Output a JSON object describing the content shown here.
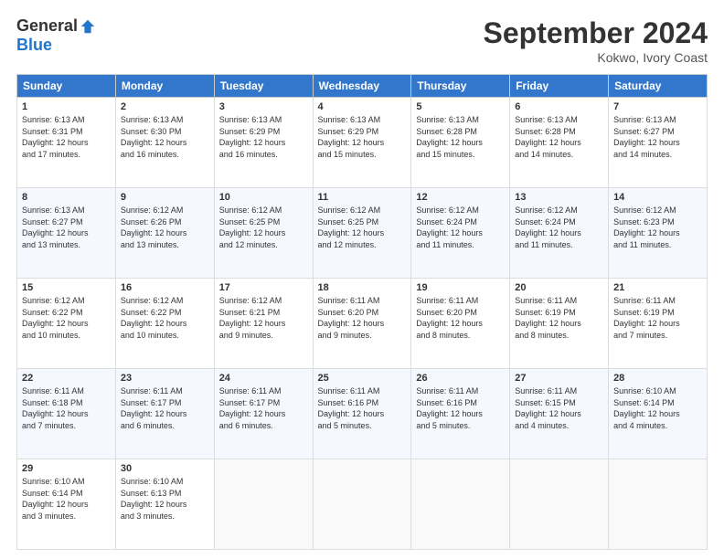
{
  "logo": {
    "general": "General",
    "blue": "Blue"
  },
  "title": "September 2024",
  "location": "Kokwo, Ivory Coast",
  "days_header": [
    "Sunday",
    "Monday",
    "Tuesday",
    "Wednesday",
    "Thursday",
    "Friday",
    "Saturday"
  ],
  "weeks": [
    [
      {
        "day": "1",
        "sunrise": "6:13 AM",
        "sunset": "6:31 PM",
        "daylight": "12 hours and 17 minutes."
      },
      {
        "day": "2",
        "sunrise": "6:13 AM",
        "sunset": "6:30 PM",
        "daylight": "12 hours and 16 minutes."
      },
      {
        "day": "3",
        "sunrise": "6:13 AM",
        "sunset": "6:29 PM",
        "daylight": "12 hours and 16 minutes."
      },
      {
        "day": "4",
        "sunrise": "6:13 AM",
        "sunset": "6:29 PM",
        "daylight": "12 hours and 15 minutes."
      },
      {
        "day": "5",
        "sunrise": "6:13 AM",
        "sunset": "6:28 PM",
        "daylight": "12 hours and 15 minutes."
      },
      {
        "day": "6",
        "sunrise": "6:13 AM",
        "sunset": "6:28 PM",
        "daylight": "12 hours and 14 minutes."
      },
      {
        "day": "7",
        "sunrise": "6:13 AM",
        "sunset": "6:27 PM",
        "daylight": "12 hours and 14 minutes."
      }
    ],
    [
      {
        "day": "8",
        "sunrise": "6:13 AM",
        "sunset": "6:27 PM",
        "daylight": "12 hours and 13 minutes."
      },
      {
        "day": "9",
        "sunrise": "6:12 AM",
        "sunset": "6:26 PM",
        "daylight": "12 hours and 13 minutes."
      },
      {
        "day": "10",
        "sunrise": "6:12 AM",
        "sunset": "6:25 PM",
        "daylight": "12 hours and 12 minutes."
      },
      {
        "day": "11",
        "sunrise": "6:12 AM",
        "sunset": "6:25 PM",
        "daylight": "12 hours and 12 minutes."
      },
      {
        "day": "12",
        "sunrise": "6:12 AM",
        "sunset": "6:24 PM",
        "daylight": "12 hours and 11 minutes."
      },
      {
        "day": "13",
        "sunrise": "6:12 AM",
        "sunset": "6:24 PM",
        "daylight": "12 hours and 11 minutes."
      },
      {
        "day": "14",
        "sunrise": "6:12 AM",
        "sunset": "6:23 PM",
        "daylight": "12 hours and 11 minutes."
      }
    ],
    [
      {
        "day": "15",
        "sunrise": "6:12 AM",
        "sunset": "6:22 PM",
        "daylight": "12 hours and 10 minutes."
      },
      {
        "day": "16",
        "sunrise": "6:12 AM",
        "sunset": "6:22 PM",
        "daylight": "12 hours and 10 minutes."
      },
      {
        "day": "17",
        "sunrise": "6:12 AM",
        "sunset": "6:21 PM",
        "daylight": "12 hours and 9 minutes."
      },
      {
        "day": "18",
        "sunrise": "6:11 AM",
        "sunset": "6:20 PM",
        "daylight": "12 hours and 9 minutes."
      },
      {
        "day": "19",
        "sunrise": "6:11 AM",
        "sunset": "6:20 PM",
        "daylight": "12 hours and 8 minutes."
      },
      {
        "day": "20",
        "sunrise": "6:11 AM",
        "sunset": "6:19 PM",
        "daylight": "12 hours and 8 minutes."
      },
      {
        "day": "21",
        "sunrise": "6:11 AM",
        "sunset": "6:19 PM",
        "daylight": "12 hours and 7 minutes."
      }
    ],
    [
      {
        "day": "22",
        "sunrise": "6:11 AM",
        "sunset": "6:18 PM",
        "daylight": "12 hours and 7 minutes."
      },
      {
        "day": "23",
        "sunrise": "6:11 AM",
        "sunset": "6:17 PM",
        "daylight": "12 hours and 6 minutes."
      },
      {
        "day": "24",
        "sunrise": "6:11 AM",
        "sunset": "6:17 PM",
        "daylight": "12 hours and 6 minutes."
      },
      {
        "day": "25",
        "sunrise": "6:11 AM",
        "sunset": "6:16 PM",
        "daylight": "12 hours and 5 minutes."
      },
      {
        "day": "26",
        "sunrise": "6:11 AM",
        "sunset": "6:16 PM",
        "daylight": "12 hours and 5 minutes."
      },
      {
        "day": "27",
        "sunrise": "6:11 AM",
        "sunset": "6:15 PM",
        "daylight": "12 hours and 4 minutes."
      },
      {
        "day": "28",
        "sunrise": "6:10 AM",
        "sunset": "6:14 PM",
        "daylight": "12 hours and 4 minutes."
      }
    ],
    [
      {
        "day": "29",
        "sunrise": "6:10 AM",
        "sunset": "6:14 PM",
        "daylight": "12 hours and 3 minutes."
      },
      {
        "day": "30",
        "sunrise": "6:10 AM",
        "sunset": "6:13 PM",
        "daylight": "12 hours and 3 minutes."
      },
      null,
      null,
      null,
      null,
      null
    ]
  ]
}
